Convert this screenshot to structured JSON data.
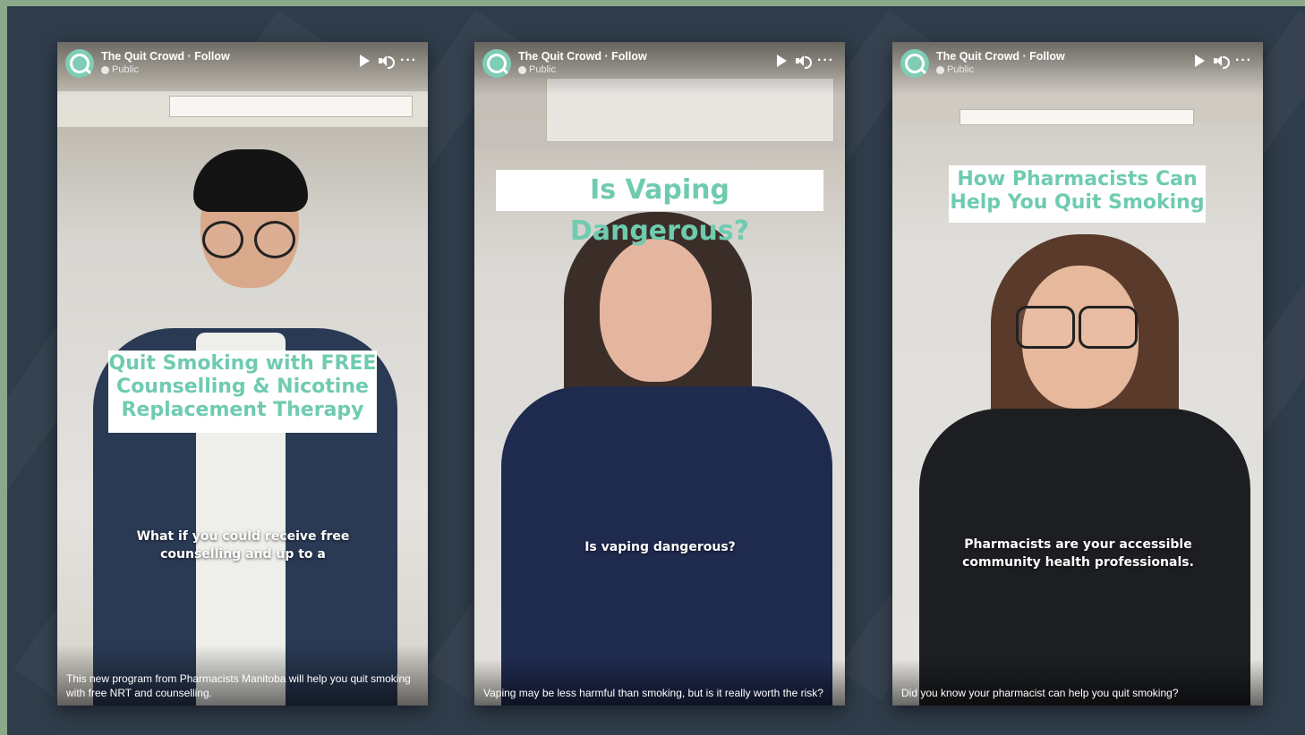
{
  "posts": [
    {
      "page_name": "The Quit Crowd · Follow",
      "privacy": "Public",
      "title": "Quit Smoking with FREE Counselling & Nicotine Replacement Therapy",
      "caption": "What if you could receive free counselling and up to a",
      "description": "This new program from Pharmacists Manitoba will help you quit smoking with free NRT and counselling."
    },
    {
      "page_name": "The Quit Crowd · Follow",
      "privacy": "Public",
      "title": "Is Vaping Dangerous?",
      "caption": "Is vaping dangerous?",
      "description": "Vaping may be less harmful than smoking, but is it really worth the risk?"
    },
    {
      "page_name": "The Quit Crowd · Follow",
      "privacy": "Public",
      "title": "How Pharmacists Can Help You Quit Smoking",
      "caption": "Pharmacists are your accessible community health professionals.",
      "description": "Did you know your pharmacist can help you quit smoking?"
    }
  ],
  "colors": {
    "brand_teal": "#6fcbb0",
    "background": "#2f3c4a",
    "frame": "#8aa88a"
  }
}
